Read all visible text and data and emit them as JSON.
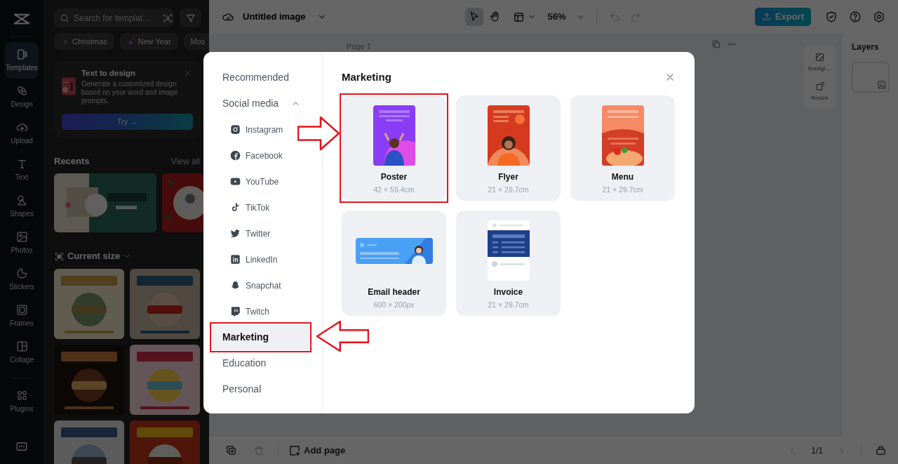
{
  "rail": {
    "items": [
      {
        "label": "Templates",
        "selected": true
      },
      {
        "label": "Design",
        "selected": false
      },
      {
        "label": "Upload",
        "selected": false
      },
      {
        "label": "Text",
        "selected": false
      },
      {
        "label": "Shapes",
        "selected": false
      },
      {
        "label": "Photos",
        "selected": false
      },
      {
        "label": "Stickers",
        "selected": false
      },
      {
        "label": "Frames",
        "selected": false
      },
      {
        "label": "Collage",
        "selected": false
      },
      {
        "label": "Plugins",
        "selected": false
      }
    ]
  },
  "panel": {
    "search": {
      "placeholder": "Search for templat…"
    },
    "chips": [
      "Christmas",
      "New Year",
      "Mos"
    ],
    "promo": {
      "title": "Text to design",
      "description": "Generate a customized design based on your word and image prompts.",
      "button": "Try →"
    },
    "recents": {
      "title": "Recents",
      "link": "View all"
    },
    "current_size": {
      "title": "Current size"
    }
  },
  "topbar": {
    "title": "Untitled image",
    "tools": [
      {
        "selected": true
      },
      {
        "selected": false
      }
    ],
    "zoom": "56%",
    "history": [
      {
        "disabled": true
      },
      {
        "disabled": true
      }
    ],
    "export": "Export"
  },
  "canvas": {
    "page_label": "Page 1"
  },
  "side_tools": [
    "Backgr…",
    "Resize"
  ],
  "layers": {
    "title": "Layers"
  },
  "bottom_bar": {
    "delete": {
      "disabled": true
    },
    "add_page": "Add page",
    "pagination": "1/1"
  },
  "dialog": {
    "title": "Marketing",
    "categories": [
      {
        "label": "Recommended",
        "selected": false,
        "highlighted": false
      },
      {
        "label": "Social media",
        "selected": false,
        "highlighted": false,
        "expanded": true,
        "children": [
          {
            "label": "Instagram",
            "selected": false
          },
          {
            "label": "Facebook",
            "selected": false
          },
          {
            "label": "YouTube",
            "selected": false
          },
          {
            "label": "TikTok",
            "selected": false
          },
          {
            "label": "Twitter",
            "selected": false
          },
          {
            "label": "LinkedIn",
            "selected": false
          },
          {
            "label": "Snapchat",
            "selected": false
          },
          {
            "label": "Twitch",
            "selected": false
          }
        ]
      },
      {
        "label": "Marketing",
        "selected": true,
        "highlighted": true
      },
      {
        "label": "Education",
        "selected": false,
        "highlighted": false
      },
      {
        "label": "Personal",
        "selected": false,
        "highlighted": false
      }
    ],
    "templates": [
      {
        "kind": "poster",
        "name": "Poster",
        "size": "42 × 59.4cm",
        "highlighted": true
      },
      {
        "kind": "flyer",
        "name": "Flyer",
        "size": "21 × 29.7cm",
        "highlighted": false
      },
      {
        "kind": "menu",
        "name": "Menu",
        "size": "21 × 29.7cm",
        "highlighted": false
      },
      {
        "kind": "email",
        "name": "Email header",
        "size": "600 × 200px",
        "highlighted": false
      },
      {
        "kind": "invoice",
        "name": "Invoice",
        "size": "21 × 29.7cm",
        "highlighted": false
      }
    ]
  }
}
